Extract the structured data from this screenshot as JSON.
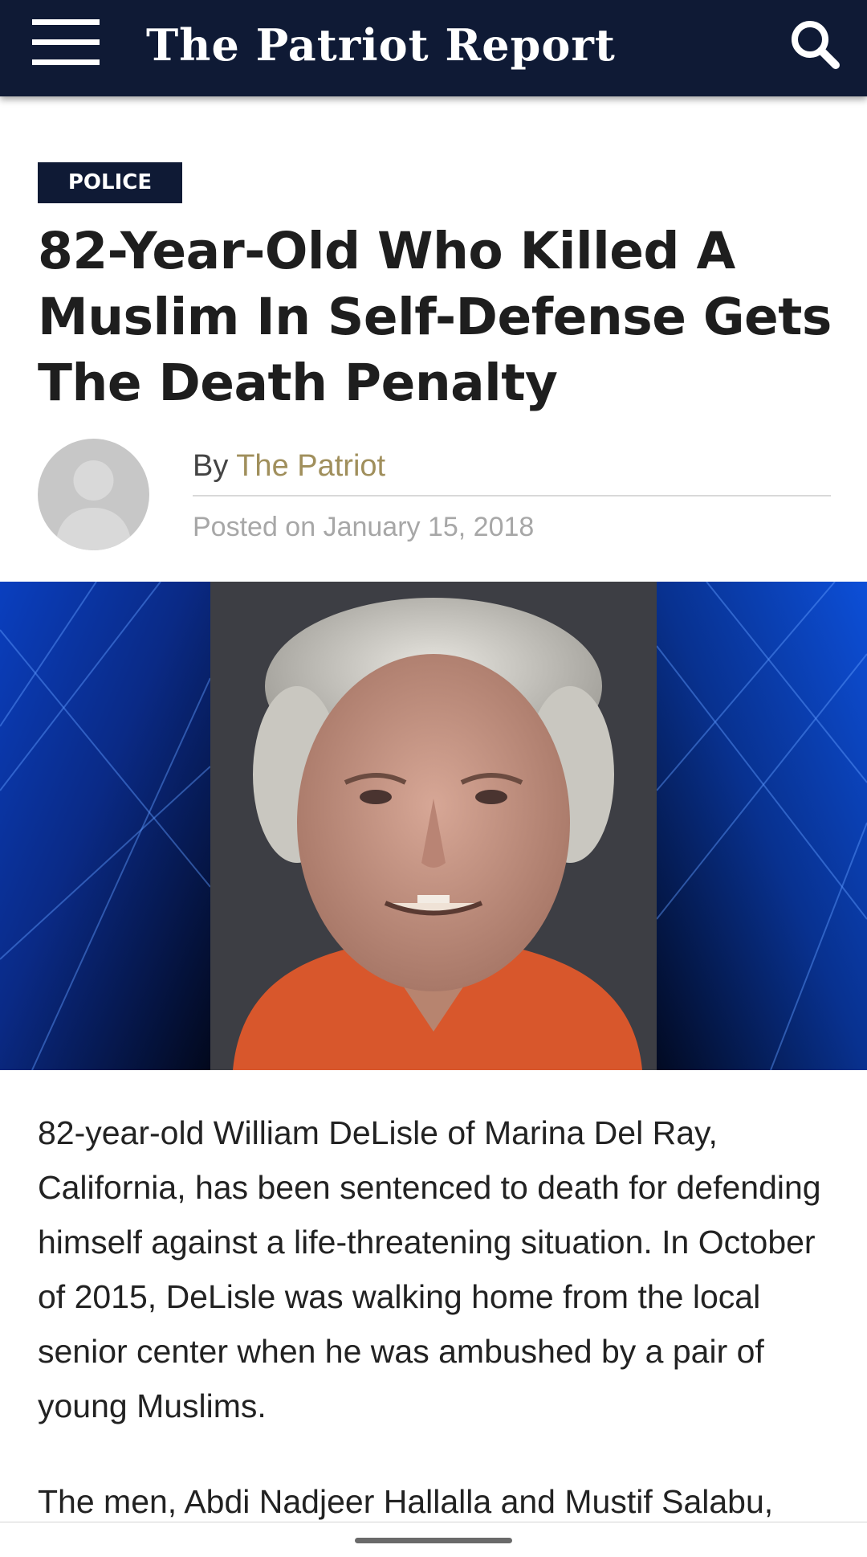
{
  "header": {
    "site_title": "The Patriot Report"
  },
  "article": {
    "category": "POLICE",
    "title": "82-Year-Old Who Killed A Muslim In Self-Defense Gets The Death Penalty",
    "by_prefix": "By ",
    "author": "The Patriot",
    "posted_prefix": "Posted on ",
    "date": "January 15, 2018",
    "paragraphs": [
      "82-year-old William DeLisle of Marina Del Ray, California, has been sentenced to death for defending himself against a life-threatening situation. In October of 2015, DeLisle was walking home from the local senior center when he was ambushed by a pair of young Muslims.",
      "The men, Abdi Nadjeer Hallalla and Mustif Salabu,"
    ]
  },
  "icons": {
    "menu": "hamburger-menu-icon",
    "search": "search-icon",
    "avatar": "user-avatar-placeholder"
  },
  "colors": {
    "header_bg": "#0f1a35",
    "category_bg": "#0f1a35",
    "author_link": "#a08f5c",
    "meta_text": "#a7a7a7",
    "headline": "#1e1e1e"
  }
}
